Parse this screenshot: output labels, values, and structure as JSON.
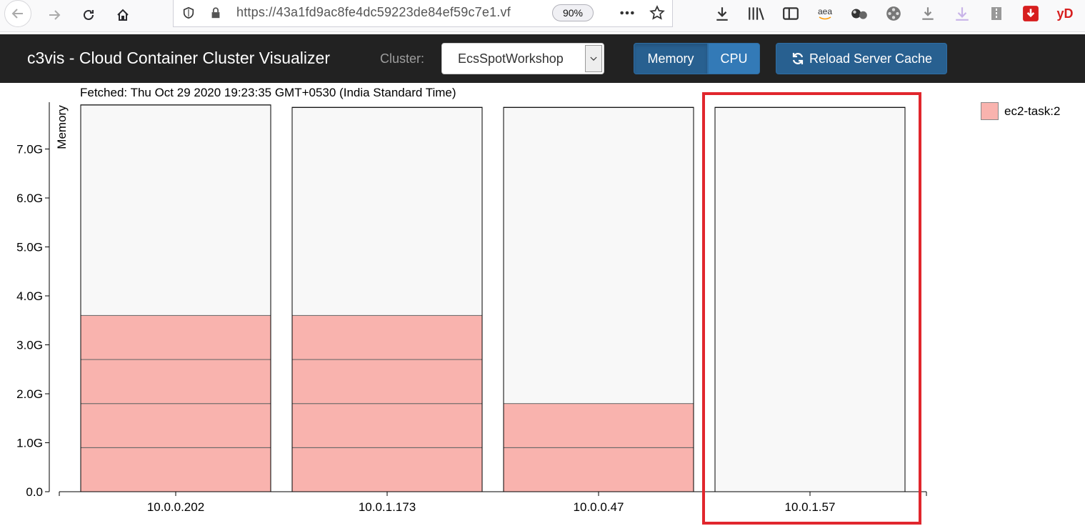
{
  "browser": {
    "url": "https://43a1fd9ac8fe4dc59223de84ef59c7e1.vf",
    "zoom": "90%",
    "toolbar_icons": [
      "download-arrow-icon",
      "library-icon",
      "sidebar-icon",
      "amazon-aea-icon",
      "bubbles-icon",
      "film-reel-icon",
      "download-icon",
      "download-light-icon",
      "zip-icon",
      "red-download-icon",
      "yd-icon"
    ],
    "ext_labels": {
      "aea": "aea",
      "yd": "yD"
    }
  },
  "app": {
    "title": "c3vis - Cloud Container Cluster Visualizer",
    "cluster_label": "Cluster:",
    "cluster_value": "EcsSpotWorkshop",
    "memory_btn": "Memory",
    "cpu_btn": "CPU",
    "reload_btn": "Reload Server Cache",
    "fetched": "Fetched: Thu Oct 29 2020 19:23:35 GMT+0530 (India Standard Time)"
  },
  "legend": {
    "label": "ec2-task:2",
    "color": "#f9b3ae"
  },
  "colors": {
    "highlight": "#e1262d",
    "bar_empty": "#f8f8f8",
    "bar_task": "#f9b3ae"
  },
  "chart_data": {
    "type": "bar",
    "ylabel": "Memory",
    "ylim": [
      0,
      8.0
    ],
    "yticks": [
      "0.0",
      "1.0G",
      "2.0G",
      "3.0G",
      "4.0G",
      "5.0G",
      "6.0G",
      "7.0G"
    ],
    "categories": [
      "10.0.0.202",
      "10.0.1.173",
      "10.0.0.47",
      "10.0.1.57"
    ],
    "capacity": [
      7.9,
      7.85,
      7.85,
      7.85
    ],
    "task_segments": [
      [
        0.9,
        0.9,
        0.9,
        0.9
      ],
      [
        0.9,
        0.9,
        0.9,
        0.9
      ],
      [
        0.9,
        0.9
      ],
      []
    ],
    "series": [
      {
        "name": "ec2-task:2",
        "values": [
          3.6,
          3.6,
          1.8,
          0
        ]
      }
    ],
    "highlighted_category": "10.0.1.57"
  }
}
